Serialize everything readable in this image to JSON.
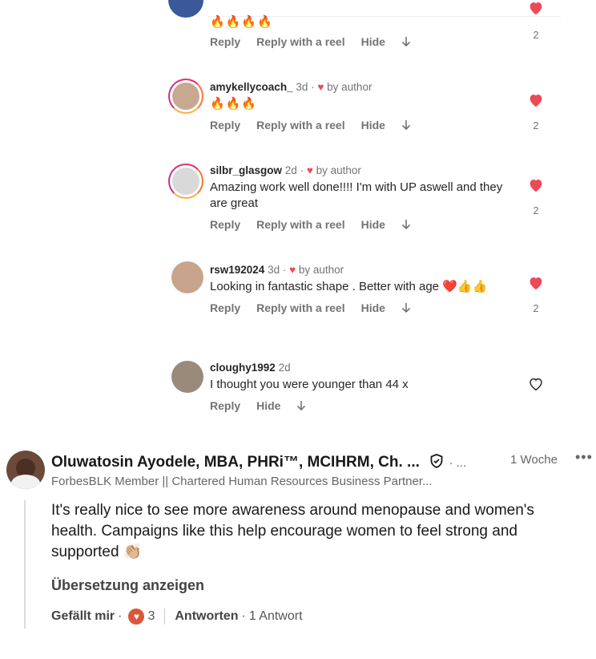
{
  "instagram_comments": {
    "top_partial": {
      "emoji": "🔥🔥🔥🔥",
      "actions": [
        "Reply",
        "Reply with a reel",
        "Hide"
      ],
      "like_count": "2"
    },
    "comments": [
      {
        "username": "amykellycoach_",
        "time": "3d",
        "liked_by_author": "by author",
        "text": "🔥🔥🔥",
        "actions": [
          "Reply",
          "Reply with a reel",
          "Hide"
        ],
        "like_count": "2",
        "liked": true
      },
      {
        "username": "silbr_glasgow",
        "time": "2d",
        "liked_by_author": "by author",
        "text": "Amazing work well done!!!! I'm with UP aswell and they are great",
        "actions": [
          "Reply",
          "Reply with a reel",
          "Hide"
        ],
        "like_count": "2",
        "liked": true
      },
      {
        "username": "rsw192024",
        "time": "3d",
        "liked_by_author": "by author",
        "text": "Looking in fantastic shape . Better with age ❤️👍👍",
        "actions": [
          "Reply",
          "Reply with a reel",
          "Hide"
        ],
        "like_count": "2",
        "liked": true
      },
      {
        "username": "cloughy1992",
        "time": "2d",
        "liked_by_author": "",
        "text": "I thought you were younger than 44 x",
        "actions": [
          "Reply",
          "Hide"
        ],
        "like_count": "",
        "liked": false
      }
    ],
    "colors": {
      "heart": "#ed4956",
      "meta": "#737373",
      "text": "#262626"
    }
  },
  "linkedin_comment": {
    "name": "Oluwatosin Ayodele, MBA, PHRi™, MCIHRM, Ch. ...",
    "verified_icon": "shield-check-icon",
    "dot_menu": "· ...",
    "time": "1 Woche",
    "more": "•••",
    "headline": "ForbesBLK Member || Chartered Human Resources Business Partner...",
    "text": "It's really nice to see more awareness around menopause and women's health. Campaigns like this help encourage women to feel strong and supported 👏🏼",
    "translate": "Übersetzung anzeigen",
    "like_label": "Gefällt mir",
    "reaction_count": "3",
    "reply_label": "Antworten",
    "reply_count": "1 Antwort"
  }
}
